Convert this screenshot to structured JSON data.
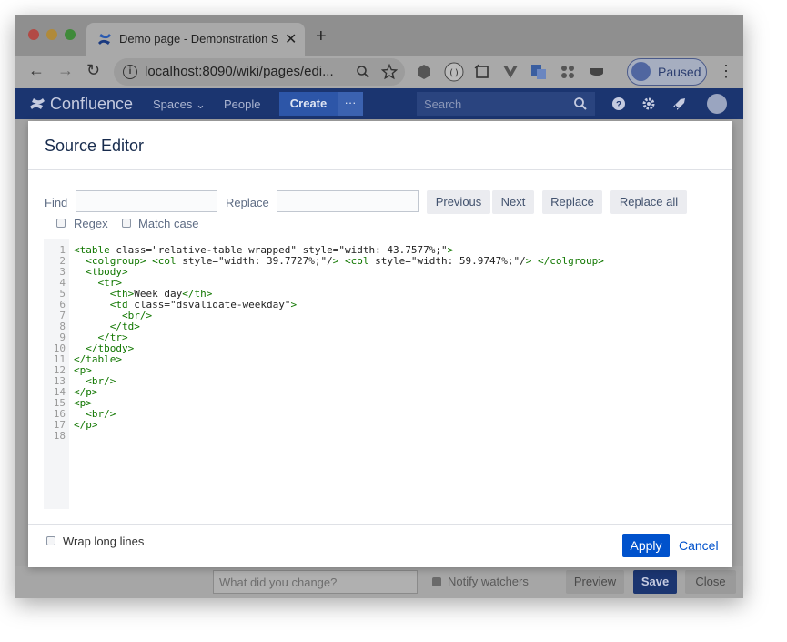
{
  "browser": {
    "tab_title": "Demo page - Demonstration Sp",
    "tab_close": "✕",
    "new_tab": "+",
    "url": "localhost:8090/wiki/pages/edi...",
    "profile_status": "Paused",
    "back": "←",
    "forward": "→",
    "reload": "↻",
    "menu": "⋮"
  },
  "confluence_nav": {
    "logo_text": "Confluence",
    "spaces": "Spaces ⌄",
    "people": "People",
    "create": "Create",
    "more": "···",
    "search_placeholder": "Search"
  },
  "dialog": {
    "title": "Source Editor",
    "find_label": "Find",
    "find_value": "",
    "replace_label": "Replace",
    "replace_value": "",
    "previous_button": "Previous",
    "next_button": "Next",
    "replace_button": "Replace",
    "replace_all_button": "Replace all",
    "regex_label": "Regex",
    "match_case_label": "Match case",
    "wrap_label": "Wrap long lines",
    "apply_button": "Apply",
    "cancel_link": "Cancel"
  },
  "line_numbers": [
    "1",
    "2",
    "3",
    "4",
    "5",
    "6",
    "7",
    "8",
    "9",
    "10",
    "11",
    "12",
    "13",
    "14",
    "15",
    "16",
    "17",
    "18"
  ],
  "code_lines": [
    "<table class=\"relative-table wrapped\" style=\"width: 43.7577%;\">",
    "  <colgroup> <col style=\"width: 39.7727%;\"/> <col style=\"width: 59.9747%;\"/> </colgroup>",
    "  <tbody>",
    "    <tr>",
    "      <th>Week day</th>",
    "      <td class=\"dsvalidate-weekday\">",
    "        <br/>",
    "      </td>",
    "    </tr>",
    "  </tbody>",
    "</table>",
    "<p>",
    "  <br/>",
    "</p>",
    "<p>",
    "  <br/>",
    "</p>",
    ""
  ],
  "page_footer": {
    "change_placeholder": "What did you change?",
    "notify_label": "Notify watchers",
    "preview_button": "Preview",
    "save_button": "Save",
    "close_button": "Close"
  },
  "colors": {
    "confluence_blue": "#0052cc",
    "nav_bg": "#1b3570",
    "tag_green": "#117700",
    "attr_blue": "#0000cc",
    "string_red": "#aa1111"
  }
}
